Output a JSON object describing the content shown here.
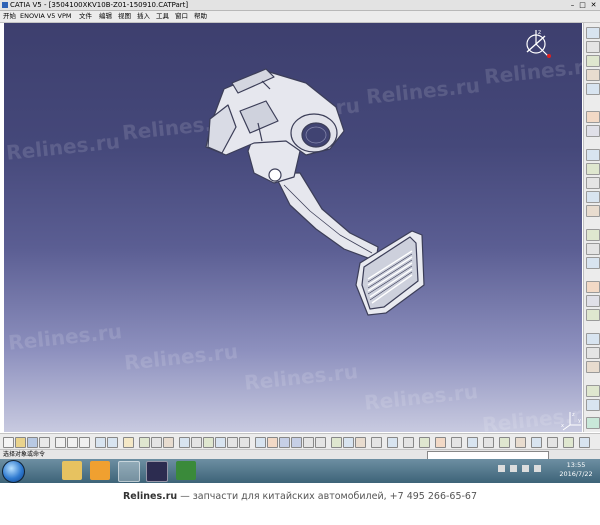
{
  "window": {
    "title": "CATIA V5 - [3504100XKV10B-Z01-150910.CATPart]",
    "min_glyph": "–",
    "max_glyph": "□",
    "close_glyph": "✕"
  },
  "menu": {
    "items": [
      "开始",
      "ENOVIA V5 VPM",
      "文件",
      "编辑",
      "视图",
      "插入",
      "工具",
      "窗口",
      "帮助"
    ]
  },
  "watermark": {
    "text": "Relines.ru"
  },
  "compass": {
    "label": "z"
  },
  "axis": {
    "x_label": "x",
    "y_label": "y",
    "z_label": "z"
  },
  "status": {
    "prompt": "选择对象或命令"
  },
  "taskbar": {
    "time": "13:55",
    "date": "2016/7/22",
    "apps": [
      "windows-explorer",
      "media-player",
      "catia-editor",
      "photo-viewer",
      "spreadsheet"
    ]
  },
  "footer": {
    "site": "Relines.ru",
    "text": " — запчасти для китайских автомобилей, +7 495 266-65-67"
  },
  "colors": {
    "viewport_top": "#3d3f6e",
    "viewport_bottom": "#c8cae0",
    "taskbar": "#4a7087",
    "part_fill": "#e6e7ee",
    "part_edge": "#3c3e58"
  }
}
